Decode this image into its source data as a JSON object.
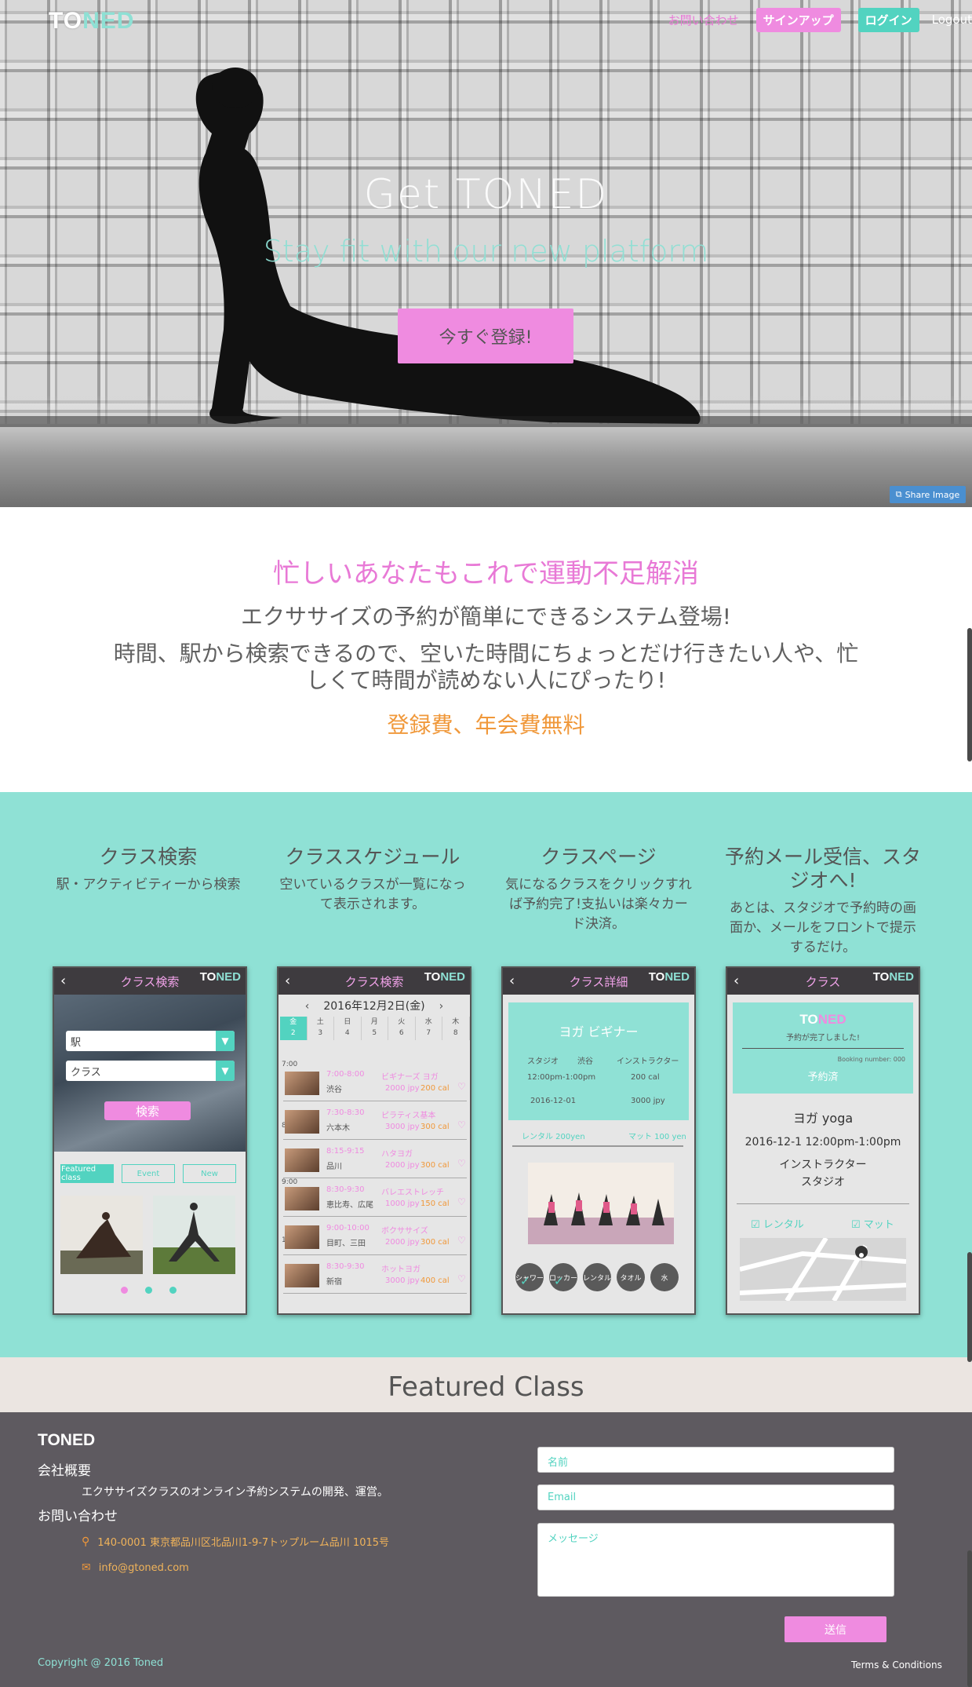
{
  "brand": {
    "logo_to": "TO",
    "logo_ned": "NED",
    "name": "TONED"
  },
  "nav": {
    "contact": "お問い合わせ",
    "signup": "サインアップ",
    "login": "ログイン",
    "logout": "Logout"
  },
  "hero": {
    "title": "Get TONED",
    "subtitle": "Stay fit with our new platform",
    "cta": "今すぐ登録!",
    "share": "Share Image"
  },
  "intro": {
    "headline": "忙しいあなたもこれで運動不足解消",
    "line1": "エクササイズの予約が簡単にできるシステム登場!",
    "line2": "時間、駅から検索できるので、空いた時間にちょっとだけ行きたい人や、忙しくて時間が読めない人にぴったり!",
    "free": "登録費、年会費無料"
  },
  "features": [
    {
      "title": "クラス検索",
      "desc": "駅・アクティビティーから検索"
    },
    {
      "title": "クラススケジュール",
      "desc": "空いているクラスが一覧になって表示されます。"
    },
    {
      "title": "クラスページ",
      "desc": "気になるクラスをクリックすれば予約完了!支払いは楽々カード決済。"
    },
    {
      "title": "予約メール受信、スタジオへ!",
      "desc": "あとは、スタジオで予約時の画面か、メールをフロントで提示するだけ。"
    }
  ],
  "phone1": {
    "title": "クラス検索",
    "station": "駅",
    "class": "クラス",
    "search": "検索",
    "tabs": [
      "Featured class",
      "Event",
      "New"
    ]
  },
  "phone2": {
    "title": "クラス検索",
    "date": "2016年12月2日(金)",
    "days": [
      {
        "w": "金",
        "d": "2"
      },
      {
        "w": "土",
        "d": "3"
      },
      {
        "w": "日",
        "d": "4"
      },
      {
        "w": "月",
        "d": "5"
      },
      {
        "w": "火",
        "d": "6"
      },
      {
        "w": "水",
        "d": "7"
      },
      {
        "w": "木",
        "d": "8"
      }
    ],
    "hours": [
      "7:00",
      "8:00",
      "9:00",
      "10:00"
    ],
    "rows": [
      {
        "time": "7:00-8:00",
        "name": "ビギナーズ ヨガ",
        "loc": "渋谷",
        "price": "2000 jpy",
        "cal": "200 cal"
      },
      {
        "time": "7:30-8:30",
        "name": "ピラティス基本",
        "loc": "六本木",
        "price": "3000 jpy",
        "cal": "300 cal"
      },
      {
        "time": "8:15-9:15",
        "name": "ハタヨガ",
        "loc": "品川",
        "price": "2000 jpy",
        "cal": "300 cal"
      },
      {
        "time": "8:30-9:30",
        "name": "バレエストレッチ",
        "loc": "恵比寿、広尾",
        "price": "1000 jpy",
        "cal": "150 cal"
      },
      {
        "time": "9:00-10:00",
        "name": "ボクササイズ",
        "loc": "目町、三田",
        "price": "2000 jpy",
        "cal": "300 cal"
      },
      {
        "time": "8:30-9:30",
        "name": "ホットヨガ",
        "loc": "新宿",
        "price": "3000 jpy",
        "cal": "400 cal"
      }
    ]
  },
  "phone3": {
    "title": "クラス詳細",
    "class_name": "ヨガ ビギナー",
    "studio_label": "スタジオ",
    "studio": "渋谷",
    "instructor_label": "インストラクター",
    "time": "12:00pm-1:00pm",
    "cal": "200 cal",
    "date": "2016-12-01",
    "price": "3000 jpy",
    "rental": "レンタル 200yen",
    "mat": "マット 100 yen",
    "options": [
      "シャワー",
      "ロッカー",
      "レンタル",
      "タオル",
      "水"
    ]
  },
  "phone4": {
    "title": "クラス",
    "done": "予約が完了しました!",
    "booking": "Booking number: 000",
    "status": "予約済",
    "class_name": "ヨガ yoga",
    "datetime": "2016-12-1   12:00pm-1:00pm",
    "instructor": "インストラクター",
    "studio": "スタジオ",
    "rental": "レンタル",
    "mat": "マット"
  },
  "featured": {
    "title": "Featured Class"
  },
  "footer": {
    "brand": "TONED",
    "about_h": "会社概要",
    "about": "エクササイズクラスのオンライン予約システムの開発、運営。",
    "contact_h": "お問い合わせ",
    "address": "140-0001 東京都品川区北品川1-9-7トップルーム品川 1015号",
    "email": "info@gtoned.com",
    "name_ph": "名前",
    "email_ph": "Email",
    "message_ph": "メッセージ",
    "send": "送信",
    "copyright": "Copyright @ 2016 Toned",
    "terms": "Terms & Conditions"
  },
  "colors": {
    "pink": "#ef8be0",
    "teal": "#52d3c0",
    "mint": "#8fe1d5",
    "orange": "#f0983a",
    "footer": "#5e5a60"
  }
}
